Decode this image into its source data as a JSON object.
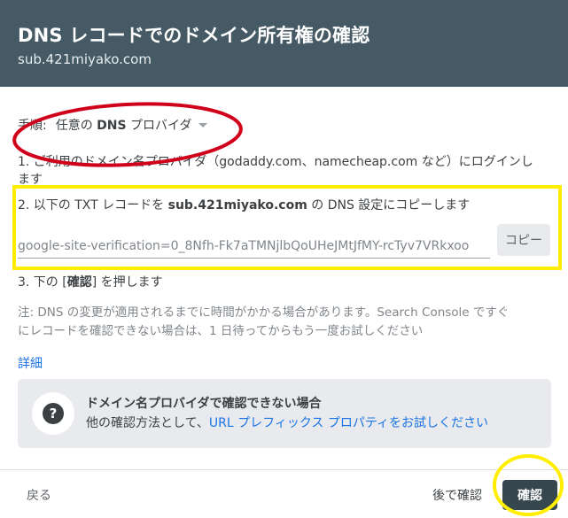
{
  "dialog": {
    "title": "DNS レコードでのドメイン所有権の確認",
    "domain": "sub.421miyako.com"
  },
  "steps": {
    "label": "手順:",
    "provider_prefix": "任意の ",
    "provider_bold": "DNS",
    "provider_suffix": " プロバイダ",
    "step1_line1": "1. ご利用のドメイン名プロバイダ（godaddy.com、namecheap.com など）にログインし",
    "step1_line2": "ます",
    "step2_prefix": "2. 以下の TXT レコードを ",
    "step2_domain": "sub.421miyako.com",
    "step2_suffix": " の DNS 設定にコピーします",
    "txt_record": "google-site-verification=0_8Nfh-Fk7aTMNjlbQoUHeJMtJfMY-rcTyv7VRkxoo",
    "copy_label": "コピー",
    "step3_prefix": "3. 下の [",
    "step3_bold": "確認",
    "step3_suffix": "] を押します"
  },
  "note": {
    "line1": "注: DNS の変更が適用されるまでに時間がかかる場合があります。Search Console ですぐ",
    "line2": "にレコードを確認できない場合は、1 日待ってからもう一度お試しください"
  },
  "details_link": "詳細",
  "info_box": {
    "title": "ドメイン名プロバイダで確認できない場合",
    "body_prefix": "他の確認方法として、",
    "body_link": "URL プレフィックス プロパティをお試しください"
  },
  "footer": {
    "back_label": "戻る",
    "later_label": "後で確認",
    "verify_label": "確認"
  },
  "colors": {
    "header_bg": "#455a64",
    "accent_link": "#1a73e8",
    "primary_button": "#37474f",
    "annotation_red": "#d0021b",
    "annotation_yellow": "#ffee00"
  }
}
